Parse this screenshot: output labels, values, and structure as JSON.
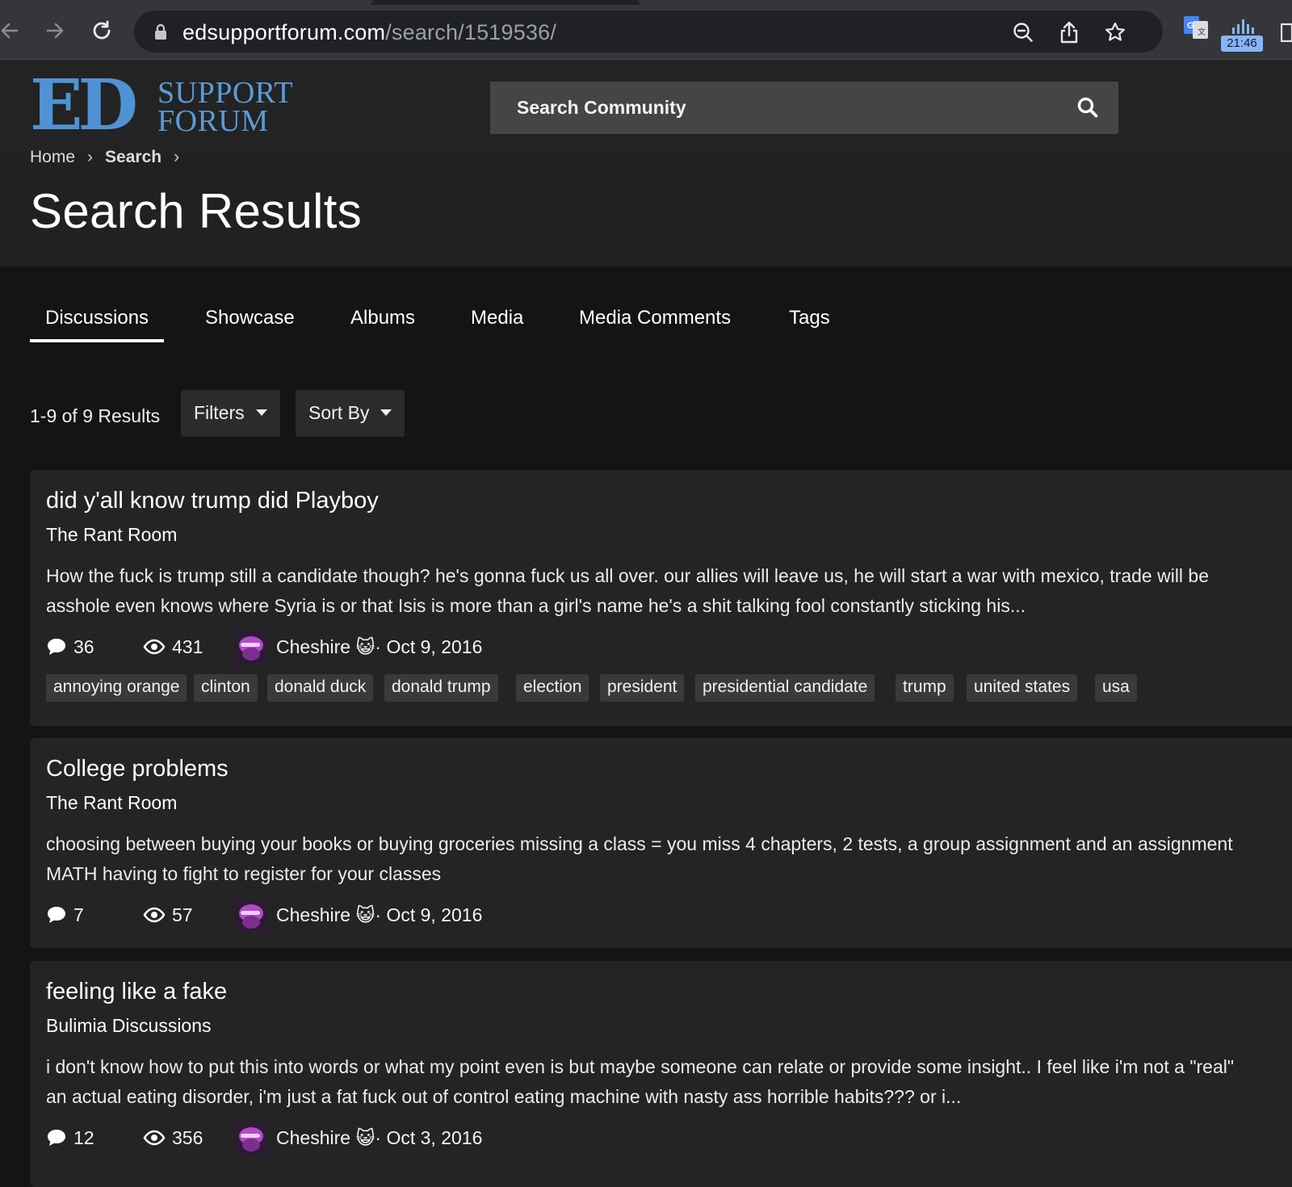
{
  "browser": {
    "url_domain": "edsupportforum.com",
    "url_path": "/search/1519536/",
    "clock": "21:46"
  },
  "site": {
    "logo_ed": "ED",
    "logo_line1": "SUPPORT",
    "logo_line2": "FORUM",
    "search_placeholder": "Search Community"
  },
  "breadcrumb": {
    "home": "Home",
    "search": "Search"
  },
  "page_title": "Search Results",
  "tabs": [
    "Discussions",
    "Showcase",
    "Albums",
    "Media",
    "Media Comments",
    "Tags"
  ],
  "toolbar": {
    "results_count": "1-9 of 9 Results",
    "filters_label": "Filters",
    "sort_label": "Sort By"
  },
  "results": [
    {
      "title": "did y'all know trump did Playboy",
      "forum": "The Rant Room",
      "snippet_line1": "How the fuck is trump still a candidate though? he's gonna fuck us all over. our allies will leave us, he will start a war with mexico, trade will be",
      "snippet_line2": "asshole even knows where Syria is or that Isis is more than a girl's name he's a shit talking fool constantly sticking his...",
      "replies": "36",
      "views": "431",
      "author": "Cheshire",
      "date": "· Oct 9, 2016",
      "tags": [
        "annoying orange",
        "clinton",
        "donald duck",
        "donald trump",
        "election",
        "president",
        "presidential candidate",
        "trump",
        "united states",
        "usa"
      ]
    },
    {
      "title": "College problems",
      "forum": "The Rant Room",
      "snippet_line1": "choosing between buying your books or buying groceries missing a class = you miss 4 chapters, 2 tests, a group assignment and an assignment",
      "snippet_line2": "MATH having to fight to register for your classes",
      "replies": "7",
      "views": "57",
      "author": "Cheshire",
      "date": "· Oct 9, 2016"
    },
    {
      "title": "feeling like a fake",
      "forum": "Bulimia Discussions",
      "snippet_line1": "i don't know how to put this into words or what my point even is but maybe someone can relate or provide some insight.. I feel like i'm not a \"real\"",
      "snippet_line2": "an actual eating disorder, i'm just a fat fuck out of control eating machine with nasty ass horrible habits??? or i...",
      "replies": "12",
      "views": "356",
      "author": "Cheshire",
      "date": "· Oct 3, 2016"
    }
  ]
}
